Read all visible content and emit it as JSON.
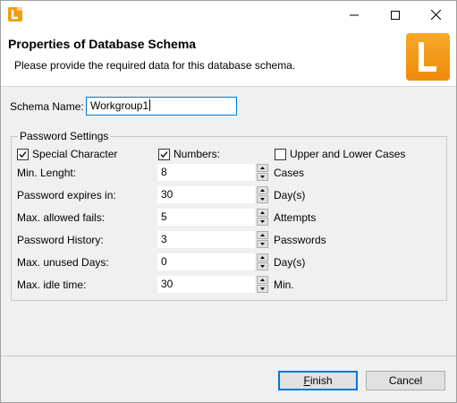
{
  "header": {
    "title": "Properties of Database Schema",
    "description": "Please provide the required data for this database schema."
  },
  "schema": {
    "label": "Schema Name:",
    "value": "Workgroup1"
  },
  "password_settings": {
    "group_title": "Password Settings",
    "checkboxes": [
      {
        "label": "Special Character",
        "checked": true
      },
      {
        "label": "Numbers:",
        "checked": true
      },
      {
        "label": "Upper and Lower Cases",
        "checked": false
      }
    ],
    "rows": [
      {
        "label": "Min. Lenght:",
        "value": "8",
        "unit": "Cases"
      },
      {
        "label": "Password expires in:",
        "value": "30",
        "unit": "Day(s)"
      },
      {
        "label": "Max. allowed fails:",
        "value": "5",
        "unit": "Attempts"
      },
      {
        "label": "Password History:",
        "value": "3",
        "unit": "Passwords"
      },
      {
        "label": "Max. unused Days:",
        "value": "0",
        "unit": "Day(s)"
      },
      {
        "label": "Max. idle time:",
        "value": "30",
        "unit": "Min."
      }
    ]
  },
  "buttons": {
    "finish": "Finish",
    "cancel": "Cancel"
  },
  "icons": {
    "app": "app-logo-icon",
    "logo": "l-logo-icon",
    "minimize": "minimize-icon",
    "maximize": "maximize-icon",
    "close": "close-icon"
  },
  "colors": {
    "logo_orange": "#f39c12",
    "focus_blue": "#0078d7"
  }
}
